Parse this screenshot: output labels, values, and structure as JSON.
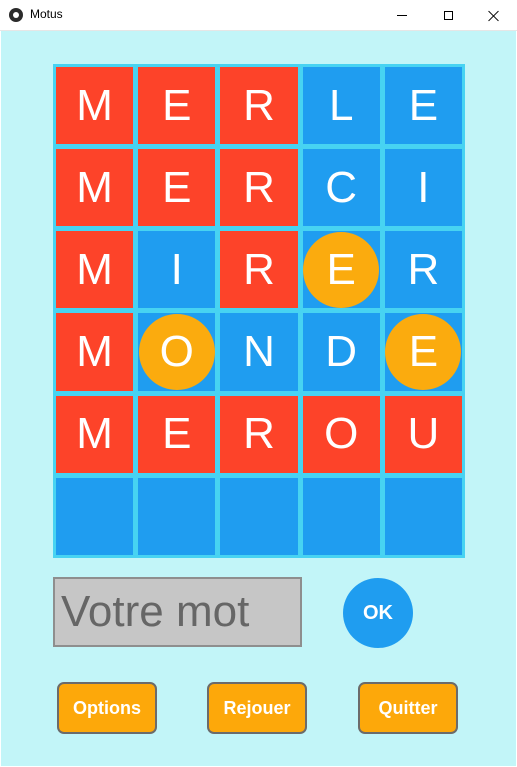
{
  "window": {
    "title": "Motus",
    "icon": "app-icon"
  },
  "board": {
    "rows": [
      [
        {
          "letter": "M",
          "state": "correct"
        },
        {
          "letter": "E",
          "state": "correct"
        },
        {
          "letter": "R",
          "state": "correct"
        },
        {
          "letter": "L",
          "state": "absent"
        },
        {
          "letter": "E",
          "state": "absent"
        }
      ],
      [
        {
          "letter": "M",
          "state": "correct"
        },
        {
          "letter": "E",
          "state": "correct"
        },
        {
          "letter": "R",
          "state": "correct"
        },
        {
          "letter": "C",
          "state": "absent"
        },
        {
          "letter": "I",
          "state": "absent"
        }
      ],
      [
        {
          "letter": "M",
          "state": "correct"
        },
        {
          "letter": "I",
          "state": "absent"
        },
        {
          "letter": "R",
          "state": "correct"
        },
        {
          "letter": "E",
          "state": "misplaced"
        },
        {
          "letter": "R",
          "state": "absent"
        }
      ],
      [
        {
          "letter": "M",
          "state": "correct"
        },
        {
          "letter": "O",
          "state": "misplaced"
        },
        {
          "letter": "N",
          "state": "absent"
        },
        {
          "letter": "D",
          "state": "absent"
        },
        {
          "letter": "E",
          "state": "misplaced"
        }
      ],
      [
        {
          "letter": "M",
          "state": "correct"
        },
        {
          "letter": "E",
          "state": "correct"
        },
        {
          "letter": "R",
          "state": "correct"
        },
        {
          "letter": "O",
          "state": "correct"
        },
        {
          "letter": "U",
          "state": "correct"
        }
      ],
      [
        {
          "letter": "",
          "state": "empty"
        },
        {
          "letter": "",
          "state": "empty"
        },
        {
          "letter": "",
          "state": "empty"
        },
        {
          "letter": "",
          "state": "empty"
        },
        {
          "letter": "",
          "state": "empty"
        }
      ]
    ]
  },
  "input": {
    "placeholder": "Votre mot",
    "value": ""
  },
  "ok_button": {
    "label": "OK"
  },
  "actions": {
    "options_label": "Options",
    "replay_label": "Rejouer",
    "quit_label": "Quitter"
  },
  "colors": {
    "background": "#c2f5f8",
    "correct": "#fd4329",
    "absent": "#1f9df0",
    "misplaced": "#fbab0e",
    "board_border": "#47d3f2",
    "button": "#fda80a"
  }
}
